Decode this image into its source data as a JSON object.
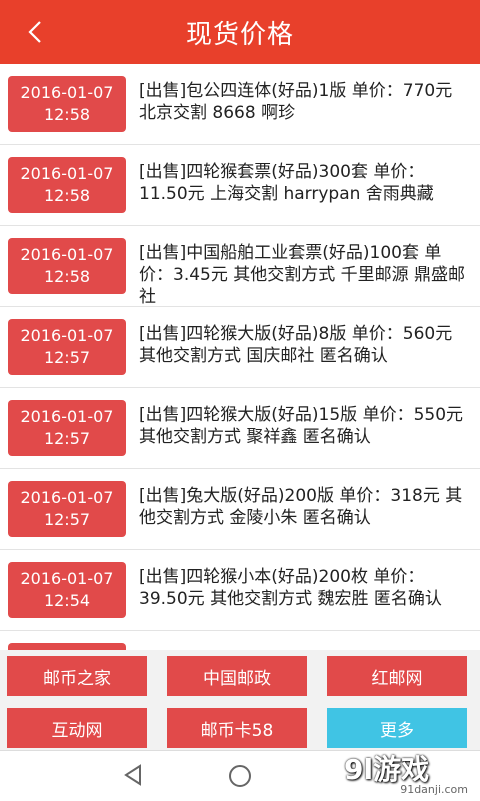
{
  "header": {
    "title": "现货价格",
    "back_icon": "chevron-left-icon"
  },
  "items": [
    {
      "date": "2016-01-07",
      "time": "12:58",
      "text": "[出售]包公四连体(好品)1版 单价：770元 北京交割 8668 啊珍"
    },
    {
      "date": "2016-01-07",
      "time": "12:58",
      "text": "[出售]四轮猴套票(好品)300套 单价：11.50元 上海交割 harrypan 舍雨典藏"
    },
    {
      "date": "2016-01-07",
      "time": "12:58",
      "text": "[出售]中国船舶工业套票(好品)100套 单价：3.45元 其他交割方式 千里邮源 鼎盛邮社"
    },
    {
      "date": "2016-01-07",
      "time": "12:57",
      "text": "[出售]四轮猴大版(好品)8版 单价：560元 其他交割方式 国庆邮社 匿名确认"
    },
    {
      "date": "2016-01-07",
      "time": "12:57",
      "text": "[出售]四轮猴大版(好品)15版 单价：550元 其他交割方式 聚祥鑫 匿名确认"
    },
    {
      "date": "2016-01-07",
      "time": "12:57",
      "text": "[出售]兔大版(好品)200版 单价：318元 其他交割方式 金陵小朱 匿名确认"
    },
    {
      "date": "2016-01-07",
      "time": "12:54",
      "text": "[出售]四轮猴小本(好品)200枚 单价：39.50元 其他交割方式 魏宏胜 匿名确认"
    },
    {
      "date": "",
      "time": "",
      "text": ""
    }
  ],
  "buttons": [
    "邮币之家",
    "中国邮政",
    "红邮网",
    "互动网",
    "邮币卡58",
    "更多"
  ],
  "colors": {
    "accent": "#e8402b",
    "badge": "#e14a4a",
    "more_button": "#40c4e4"
  },
  "watermark": {
    "logo": "9l游戏",
    "url": "91danji.com"
  }
}
